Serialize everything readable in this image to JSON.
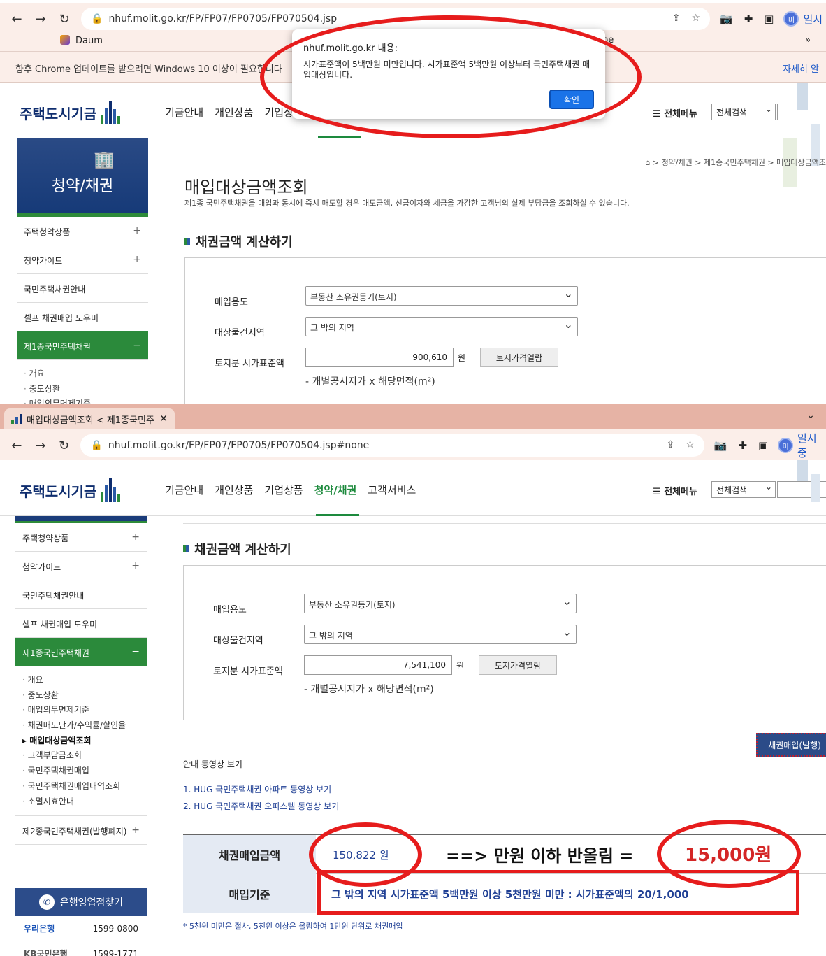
{
  "s1": {
    "address": "nhuf.molit.go.kr/FP/FP07/FP0705/FP070504.jsp",
    "profile_label": "일시",
    "bookmark_daum": "Daum",
    "bookmark_right_cut": "be",
    "bookmark_more": "»",
    "infobar_text": "향후 Chrome 업데이트를 받으려면 Windows 10 이상이 필요합니다",
    "infobar_link": "자세히 알",
    "dialog": {
      "title": "nhuf.molit.go.kr 내용:",
      "message": "시가표준액이 5백만원 미만입니다. 시가표준액 5백만원 이상부터 국민주택채권 매입대상입니다.",
      "ok": "확인"
    },
    "breadcrumb": [
      "청약/채권",
      "제1종국민주택채권",
      "매입대상금액조"
    ],
    "page_title": "매입대상금액조회",
    "page_desc": "제1종 국민주택채권을 매입과 동시에 즉시 매도할 경우 매도금액, 선급이자와 세금을 가감한 고객님의 실제 부담금을 조회하실 수 있습니다.",
    "land_value": "900,610",
    "lnb_sub_cut": "매입의무면제기준"
  },
  "s2": {
    "tab_title": "매입대상금액조회 < 제1종국민주",
    "address": "nhuf.molit.go.kr/FP/FP07/FP0705/FP070504.jsp#none",
    "profile_label": "일시중",
    "land_value": "7,541,100",
    "issue_button": "채권매입(발행)",
    "guide_title": "안내 동영상 보기",
    "video_links": [
      "1. HUG 국민주택채권 아파트 동영상 보기",
      "2. HUG 국민주택채권 오피스텔 동영상 보기"
    ],
    "result": {
      "amount_label": "채권매입금액",
      "amount_value": "150,822 원",
      "basis_label": "매입기준",
      "basis_value": "그 밖의 지역 시가표준액 5백만원 이상 5천만원 미만 : 시가표준액의 20/1,000"
    },
    "annotation_arrow": "==> 만원 이하 반올림 =",
    "annotation_result": "15,000원",
    "footnote": "* 5천원 미만은 절사, 5천원 이상은 올림하여 1만원 단위로 채권매입",
    "bank_title": "은행영업점찾기",
    "banks": [
      {
        "name": "우리은행",
        "phone": "1599-0800"
      },
      {
        "name": "KB국민은행",
        "phone": "1599-1771"
      }
    ]
  },
  "site": {
    "logo": "주택도시기금",
    "gnb": [
      "기금안내",
      "개인상품",
      "기업상품",
      "청약/채권",
      "고객서비스"
    ],
    "all_menu": "전체메뉴",
    "search_select": "전체검색",
    "lnb_hero": "청약/채권",
    "lnb": [
      "주택청약상품",
      "청약가이드",
      "국민주택채권안내",
      "셀프 채권매입 도우미",
      "제1종국민주택채권",
      "제2종국민주택채권(발행폐지)"
    ],
    "lnb_sub": [
      "개요",
      "중도상환",
      "매입의무면제기준",
      "채권매도단가/수익률/할인율",
      "매입대상금액조회",
      "고객부담금조회",
      "국민주택채권매입",
      "국민주택채권매입내역조회",
      "소멸시효안내"
    ],
    "section_title": "채권금액 계산하기",
    "form": {
      "purpose_label": "매입용도",
      "purpose_value": "부동산 소유권등기(토지)",
      "region_label": "대상물건지역",
      "region_value": "그 밖의 지역",
      "land_label": "토지분 시가표준액",
      "unit": "원",
      "price_button": "토지가격열람",
      "note": "- 개별공시지가 x 해당면적(m²)"
    }
  }
}
